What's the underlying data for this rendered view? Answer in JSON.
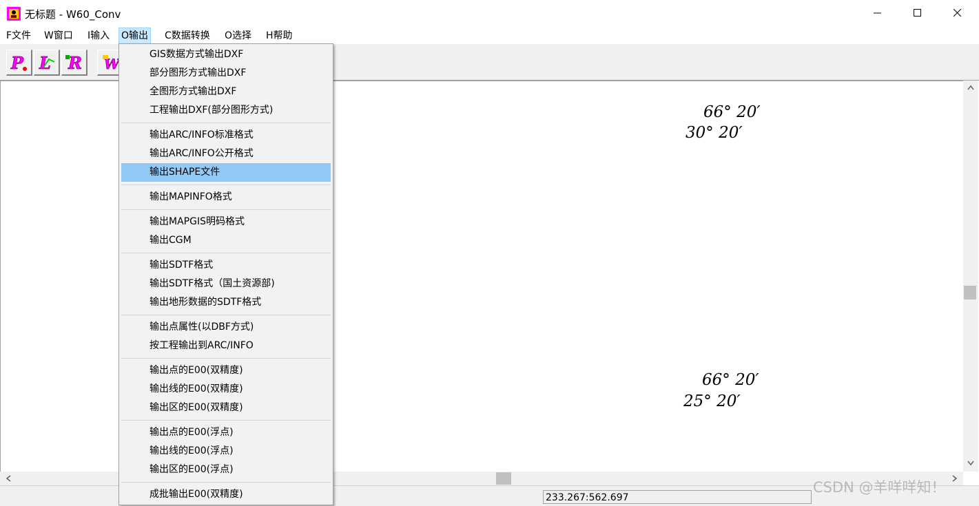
{
  "window": {
    "title": "无标题 - W60_Conv"
  },
  "menubar": {
    "items": [
      {
        "label": "F文件",
        "active": false
      },
      {
        "label": "W窗口",
        "active": false
      },
      {
        "label": "I输入",
        "active": false
      },
      {
        "label": "O输出",
        "active": true
      },
      {
        "label": "C数据转换",
        "active": false
      },
      {
        "label": "O选择",
        "active": false
      },
      {
        "label": "H帮助",
        "active": false
      }
    ]
  },
  "toolbar": {
    "buttons": [
      {
        "icon": "point-tool-icon",
        "glyph": "P"
      },
      {
        "icon": "line-tool-icon",
        "glyph": "L"
      },
      {
        "icon": "region-tool-icon",
        "glyph": "R"
      },
      {
        "icon": "network-tool-icon",
        "glyph": "W"
      }
    ]
  },
  "output_menu": {
    "groups": [
      [
        "GIS数据方式输出DXF",
        "部分图形方式输出DXF",
        "全图形方式输出DXF",
        "工程输出DXF(部分图形方式)"
      ],
      [
        "输出ARC/INFO标准格式",
        "输出ARC/INFO公开格式",
        "输出SHAPE文件"
      ],
      [
        "输出MAPINFO格式"
      ],
      [
        "输出MAPGIS明码格式",
        "输出CGM"
      ],
      [
        "输出SDTF格式",
        "输出SDTF格式（国土资源部)",
        "输出地形数据的SDTF格式"
      ],
      [
        "输出点属性(以DBF方式)",
        "按工程输出到ARC/INFO"
      ],
      [
        "输出点的E00(双精度)",
        "输出线的E00(双精度)",
        "输出区的E00(双精度)"
      ],
      [
        "输出点的E00(浮点)",
        "输出线的E00(浮点)",
        "输出区的E00(浮点)"
      ],
      [
        "成批输出E00(双精度)"
      ]
    ],
    "highlighted": "输出SHAPE文件",
    "highlight_color": "#91c9f7"
  },
  "canvas": {
    "labels": [
      "66° 20′",
      "30° 20′",
      "66° 20′",
      "25° 20′"
    ]
  },
  "statusbar": {
    "coords": "233.267:562.697"
  },
  "watermark": "CSDN @羊咩咩知！",
  "colors": {
    "menu_active_bg": "#cce8ff",
    "toolbar_bg": "#f0f0f0"
  }
}
